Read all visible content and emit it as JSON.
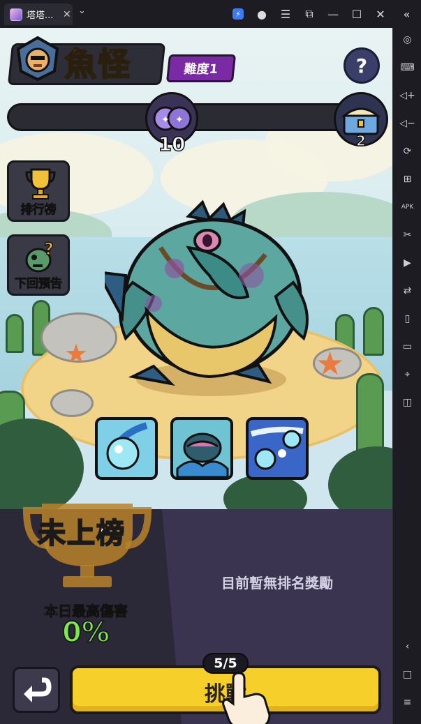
{
  "window": {
    "tab_title": "塔塔...",
    "icons": [
      "close-icon",
      "chevron-down-icon",
      "boost-icon",
      "account-icon",
      "menu-icon",
      "screenshot-icon",
      "minimize-icon",
      "maximize-icon",
      "close-window-icon",
      "collapse-sidebar-icon"
    ]
  },
  "sidebar": {
    "icons": [
      "location-settings-icon",
      "keyboard-icon",
      "volume-up-icon",
      "volume-down-icon",
      "rotate-icon",
      "multi-instance-icon",
      "apk-icon",
      "scissors-icon",
      "record-icon",
      "sync-icon",
      "shake-icon",
      "folder-icon",
      "location-icon",
      "layers-icon",
      "back-icon",
      "home-icon",
      "recent-apps-icon"
    ]
  },
  "header": {
    "boss_name": "魚怪",
    "difficulty": "難度1",
    "help_label": "?"
  },
  "progress": {
    "current_value": "10",
    "reward_value": "2"
  },
  "side_buttons": {
    "leaderboard": "排行榜",
    "next_preview": "下回預告"
  },
  "skills": [
    "water-orb-skill",
    "fish-summon-skill",
    "water-burst-skill"
  ],
  "rank": {
    "status": "未上榜",
    "no_reward_text": "目前暫無排名獎勵",
    "damage_label": "本日最高傷害",
    "damage_value": "0%"
  },
  "footer": {
    "attempts": "5/5",
    "challenge_label": "挑戰"
  },
  "colors": {
    "accent_yellow": "#f6cf2a",
    "difficulty_purple": "#7b2aa6",
    "damage_green": "#7ee84f"
  }
}
